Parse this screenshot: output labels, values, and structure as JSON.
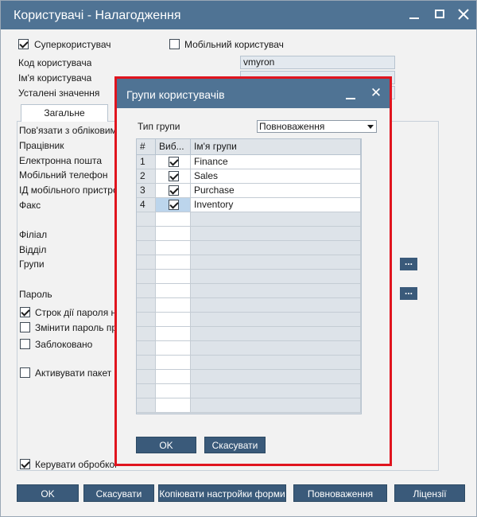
{
  "window": {
    "title": "Користувачі - Налагодження",
    "superuser_label": "Суперкористувач",
    "superuser_checked": true,
    "mobile_user_label": "Мобільний користувач",
    "mobile_user_checked": false,
    "user_code_label": "Код користувача",
    "user_code_value": "vmyron",
    "user_name_label": "Ім'я користувача",
    "defaults_label": "Усталені значення"
  },
  "tabs": [
    {
      "label": "Загальне"
    }
  ],
  "general": {
    "fields": [
      {
        "label": "Пов'язати з обліковим"
      },
      {
        "label": "Працівник"
      },
      {
        "label": "Електронна пошта"
      },
      {
        "label": "Мобільний телефон"
      },
      {
        "label": "ІД мобільного пристрою"
      },
      {
        "label": "Факс"
      },
      {
        "label": "Філіал"
      },
      {
        "label": "Відділ"
      },
      {
        "label": "Групи"
      },
      {
        "label": "Пароль"
      }
    ],
    "checkboxes": [
      {
        "label": "Строк дії пароля не",
        "checked": true
      },
      {
        "label": "Змінити пароль при",
        "checked": false
      },
      {
        "label": "Заблоковано",
        "checked": false
      },
      {
        "label": "Активувати пакет",
        "checked": false
      },
      {
        "label": "Керувати обробкою",
        "checked": true
      }
    ],
    "dots_label": "..."
  },
  "bottom_buttons": {
    "ok": "OK",
    "cancel": "Скасувати",
    "copy_settings": "Копіювати настройки форми",
    "authorizations": "Повноваження",
    "licenses": "Ліцензії"
  },
  "modal": {
    "title": "Групи користувачів",
    "close_glyph": "✕",
    "group_type_label": "Тип групи",
    "group_type_value": "Повноваження",
    "columns": {
      "num": "#",
      "selected": "Виб...",
      "name": "Ім'я групи"
    },
    "rows": [
      {
        "num": "1",
        "selected": true,
        "name": "Finance"
      },
      {
        "num": "2",
        "selected": true,
        "name": "Sales"
      },
      {
        "num": "3",
        "selected": true,
        "name": "Purchase"
      },
      {
        "num": "4",
        "selected": true,
        "name": "Inventory"
      }
    ],
    "ok": "OK",
    "cancel": "Скасувати"
  },
  "colors": {
    "titlebar": "#4f7394",
    "button": "#3a5a7a",
    "highlight_border": "#e0141e"
  }
}
